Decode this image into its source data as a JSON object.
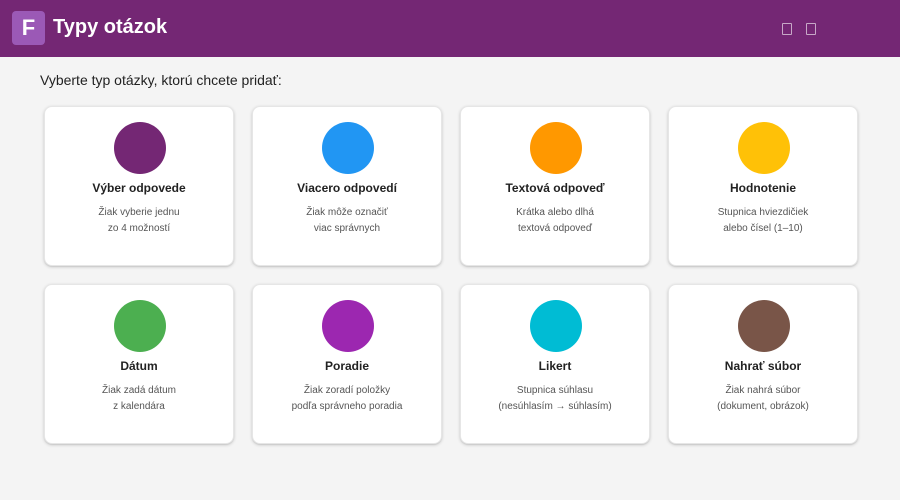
{
  "header": {
    "logo_letter": "F",
    "title": "Typy otázok",
    "color": "#742774"
  },
  "prompt": "Vyberte typ otázky, ktorú chcete pridať:",
  "cards": [
    {
      "title": "Výber odpovede",
      "desc1": "Žiak vyberie jednu",
      "desc2": "zo 4 možností",
      "color": "#742774"
    },
    {
      "title": "Viacero odpovedí",
      "desc1": "Žiak môže označiť",
      "desc2": "viac správnych",
      "color": "#2196f3"
    },
    {
      "title": "Textová odpoveď",
      "desc1": "Krátka alebo dlhá",
      "desc2": "textová odpoveď",
      "color": "#ff9800"
    },
    {
      "title": "Hodnotenie",
      "desc1": "Stupnica hviezdičiek",
      "desc2": "alebo čísel (1–10)",
      "color": "#ffc107"
    },
    {
      "title": "Dátum",
      "desc1": "Žiak zadá dátum",
      "desc2": "z kalendára",
      "color": "#4caf50"
    },
    {
      "title": "Poradie",
      "desc1": "Žiak zoradí položky",
      "desc2": "podľa správneho poradia",
      "color": "#9c27b0"
    },
    {
      "title": "Likert",
      "desc1": "Stupnica súhlasu",
      "desc2": "(nesúhlasím → súhlasím)",
      "color": "#00bcd4"
    },
    {
      "title": "Nahrať súbor",
      "desc1": "Žiak nahrá súbor",
      "desc2": "(dokument, obrázok)",
      "color": "#795548"
    }
  ]
}
